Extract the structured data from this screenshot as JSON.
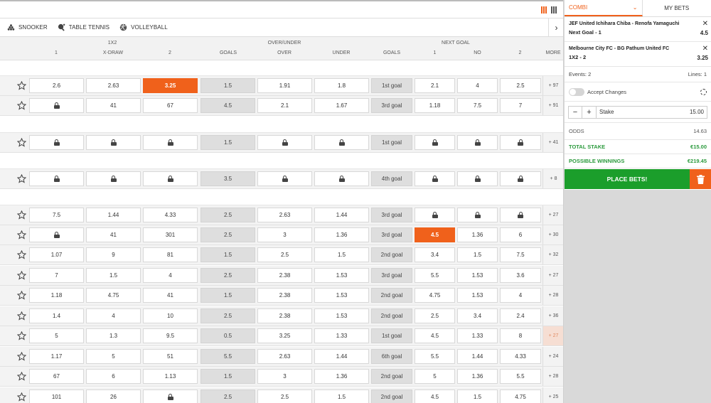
{
  "sports": [
    "SNOOKER",
    "TABLE TENNIS",
    "VOLLEYBALL"
  ],
  "headers": {
    "group_1x2": "1X2",
    "group_ou": "OVER/UNDER",
    "group_ng": "NEXT GOAL",
    "c1": "1",
    "cx": "X-DRAW",
    "c2": "2",
    "goals": "GOALS",
    "over": "OVER",
    "under": "UNDER",
    "ng_goals": "GOALS",
    "ng1": "1",
    "ngno": "NO",
    "ng2": "2",
    "more": "MORE"
  },
  "rows": [
    {
      "c": [
        "2.6",
        "2.63",
        "3.25",
        "1.5",
        "1.91",
        "1.8",
        "1st goal",
        "2.1",
        "4",
        "2.5"
      ],
      "more": "+ 97",
      "sel": 2
    },
    {
      "c": [
        "L",
        "41",
        "67",
        "4.5",
        "2.1",
        "1.67",
        "3rd goal",
        "1.18",
        "7.5",
        "7"
      ],
      "more": "+ 91"
    },
    {
      "c": [
        "L",
        "L",
        "L",
        "1.5",
        "L",
        "L",
        "1st goal",
        "L",
        "L",
        "L"
      ],
      "more": "+ 41"
    },
    {
      "c": [
        "L",
        "L",
        "L",
        "3.5",
        "L",
        "L",
        "4th goal",
        "L",
        "L",
        "L"
      ],
      "more": "+ 8"
    },
    {
      "c": [
        "7.5",
        "1.44",
        "4.33",
        "2.5",
        "2.63",
        "1.44",
        "3rd goal",
        "L",
        "L",
        "L"
      ],
      "more": "+ 27"
    },
    {
      "c": [
        "L",
        "41",
        "301",
        "2.5",
        "3",
        "1.36",
        "3rd goal",
        "4.5",
        "1.36",
        "6"
      ],
      "more": "+ 30",
      "sel": 7
    },
    {
      "c": [
        "1.07",
        "9",
        "81",
        "1.5",
        "2.5",
        "1.5",
        "2nd goal",
        "3.4",
        "1.5",
        "7.5"
      ],
      "more": "+ 32"
    },
    {
      "c": [
        "7",
        "1.5",
        "4",
        "2.5",
        "2.38",
        "1.53",
        "3rd goal",
        "5.5",
        "1.53",
        "3.6"
      ],
      "more": "+ 27"
    },
    {
      "c": [
        "1.18",
        "4.75",
        "41",
        "1.5",
        "2.38",
        "1.53",
        "2nd goal",
        "4.75",
        "1.53",
        "4"
      ],
      "more": "+ 28"
    },
    {
      "c": [
        "1.4",
        "4",
        "10",
        "2.5",
        "2.38",
        "1.53",
        "2nd goal",
        "2.5",
        "3.4",
        "2.4"
      ],
      "more": "+ 36"
    },
    {
      "c": [
        "5",
        "1.3",
        "9.5",
        "0.5",
        "3.25",
        "1.33",
        "1st goal",
        "4.5",
        "1.33",
        "8"
      ],
      "more": "+ 27",
      "hl": true
    },
    {
      "c": [
        "1.17",
        "5",
        "51",
        "5.5",
        "2.63",
        "1.44",
        "6th goal",
        "5.5",
        "1.44",
        "4.33"
      ],
      "more": "+ 24"
    },
    {
      "c": [
        "67",
        "6",
        "1.13",
        "1.5",
        "3",
        "1.36",
        "2nd goal",
        "5",
        "1.36",
        "5.5"
      ],
      "more": "+ 28"
    },
    {
      "c": [
        "101",
        "26",
        "L",
        "2.5",
        "2.5",
        "1.5",
        "2nd goal",
        "4.5",
        "1.5",
        "4.75"
      ],
      "more": "+ 25"
    }
  ],
  "betslip": {
    "tab_combi": "COMBI",
    "tab_mybets": "MY BETS",
    "bets": [
      {
        "event": "JEF United Ichihara Chiba - Renofa Yamaguchi",
        "market": "Next Goal - 1",
        "odds": "4.5"
      },
      {
        "event": "Melbourne City FC - BG Pathum United FC",
        "market": "1X2 - 2",
        "odds": "3.25"
      }
    ],
    "events_label": "Events: 2",
    "lines_label": "Lines: 1",
    "accept_changes": "Accept Changes",
    "stake_label": "Stake",
    "stake_value": "15.00",
    "odds_label": "ODDS",
    "odds_value": "14.63",
    "total_stake_label": "TOTAL STAKE",
    "total_stake_value": "€15.00",
    "possible_winnings_label": "POSSIBLE WINNINGS",
    "possible_winnings_value": "€219.45",
    "place_bets": "PLACE BETS!"
  },
  "colors": {
    "accent": "#f0611b",
    "green": "#1b9e2b"
  }
}
